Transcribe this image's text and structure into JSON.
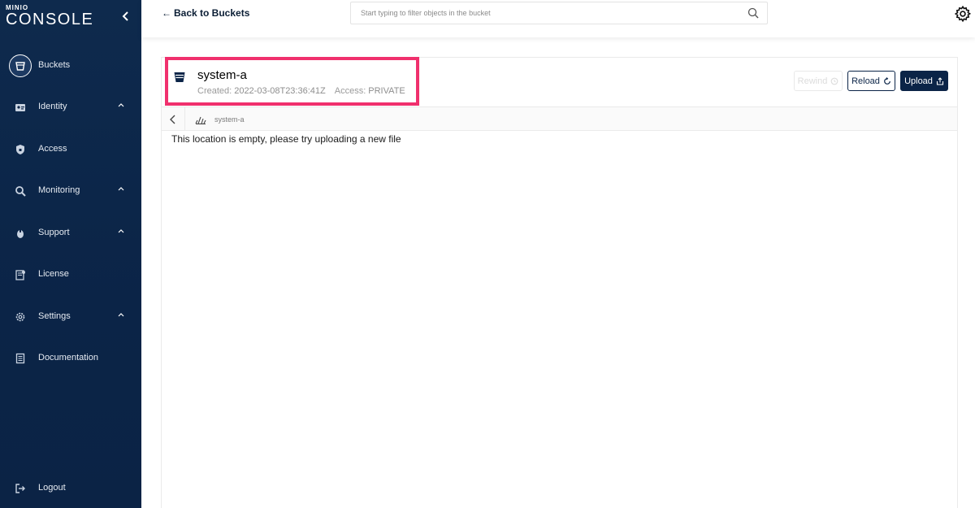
{
  "app": {
    "logo_small": "MINIO",
    "logo_large": "CONSOLE"
  },
  "sidebar": {
    "items": [
      {
        "label": "Buckets",
        "icon": "bucket-icon",
        "active": true
      },
      {
        "label": "Identity",
        "icon": "identity-card-icon",
        "expandable": true
      },
      {
        "label": "Access",
        "icon": "shield-icon"
      },
      {
        "label": "Monitoring",
        "icon": "magnifier-icon",
        "expandable": true
      },
      {
        "label": "Support",
        "icon": "support-icon",
        "expandable": true
      },
      {
        "label": "License",
        "icon": "license-icon"
      },
      {
        "label": "Settings",
        "icon": "gear-icon",
        "expandable": true
      },
      {
        "label": "Documentation",
        "icon": "document-icon"
      },
      {
        "label": "Logout",
        "icon": "logout-icon"
      }
    ]
  },
  "topbar": {
    "back_label": "Back to Buckets",
    "search_placeholder": "Start typing to filter objects in the bucket"
  },
  "bucket": {
    "name": "system-a",
    "created_label": "Created:",
    "created_value": "2022-03-08T23:36:41Z",
    "access_label": "Access:",
    "access_value": "PRIVATE"
  },
  "actions": {
    "rewind_label": "Rewind",
    "reload_label": "Reload",
    "upload_label": "Upload"
  },
  "breadcrumb": {
    "path": "system-a"
  },
  "content": {
    "empty_message": "This location is empty, please try uploading a new file"
  },
  "colors": {
    "sidebar_bg": "#0b2447",
    "highlight_border": "#f0306d",
    "primary_button": "#0b2447"
  }
}
